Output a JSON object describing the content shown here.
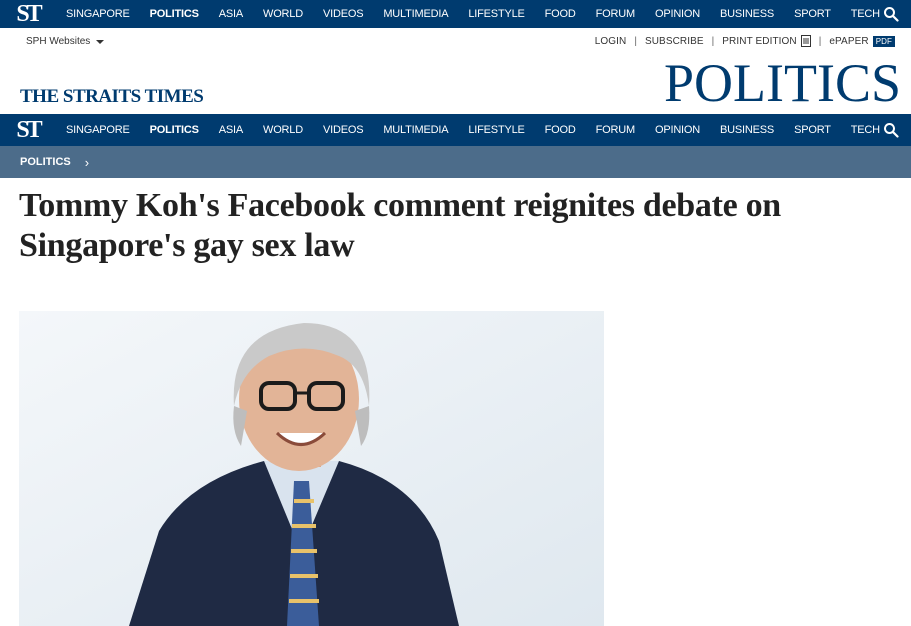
{
  "nav": {
    "logo": "ST",
    "items": [
      "SINGAPORE",
      "POLITICS",
      "ASIA",
      "WORLD",
      "VIDEOS",
      "MULTIMEDIA",
      "LIFESTYLE",
      "FOOD",
      "FORUM",
      "OPINION",
      "BUSINESS",
      "SPORT",
      "TECH"
    ],
    "active": "POLITICS"
  },
  "utility": {
    "sph_websites": "SPH Websites",
    "login": "LOGIN",
    "subscribe": "SUBSCRIBE",
    "print_edition": "PRINT EDITION",
    "epaper": "ePAPER",
    "pdf": "PDF"
  },
  "masthead": {
    "brand": "THE STRAITS TIMES",
    "section": "POLITICS"
  },
  "breadcrumb": {
    "label": "POLITICS"
  },
  "article": {
    "headline": "Tommy Koh's Facebook comment reignites debate on Singapore's gay sex law"
  },
  "colors": {
    "navy": "#003b6f",
    "breadcrumb_bg": "#4c6c8a"
  }
}
